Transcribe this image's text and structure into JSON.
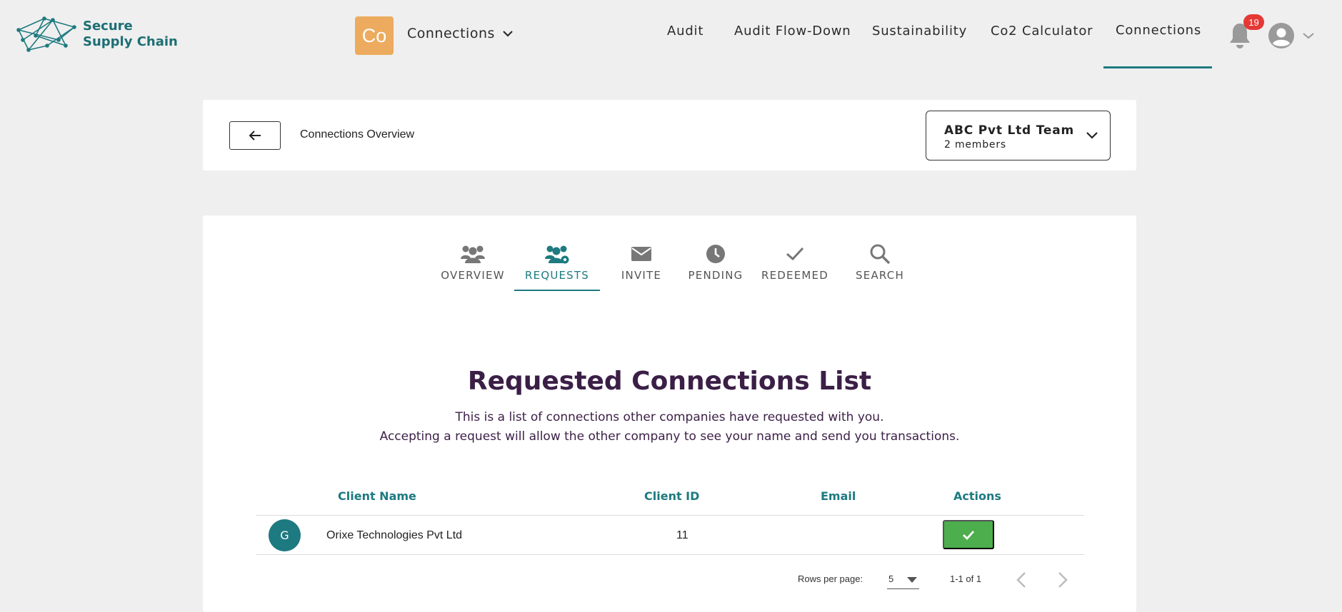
{
  "brand": {
    "line1": "Secure",
    "line2": "Supply Chain"
  },
  "app": {
    "badge": "Co",
    "name": "Connections"
  },
  "nav": {
    "items": [
      {
        "label": "Audit"
      },
      {
        "label": "Audit Flow-Down"
      },
      {
        "label": "Sustainability"
      },
      {
        "label": "Co2 Calculator"
      },
      {
        "label": "Connections",
        "active": true
      }
    ],
    "notifications_count": "19"
  },
  "overview": {
    "title": "Connections Overview"
  },
  "team": {
    "name": "ABC Pvt Ltd Team",
    "members": "2 members"
  },
  "tabs": [
    {
      "label": "OVERVIEW",
      "icon": "users-icon"
    },
    {
      "label": "REQUESTS",
      "icon": "users-cog-icon",
      "active": true
    },
    {
      "label": "INVITE",
      "icon": "envelope-icon"
    },
    {
      "label": "PENDING",
      "icon": "clock-icon"
    },
    {
      "label": "REDEEMED",
      "icon": "check-icon"
    },
    {
      "label": "SEARCH",
      "icon": "search-icon"
    }
  ],
  "requests": {
    "title": "Requested Connections List",
    "desc1": "This is a list of connections other companies have requested with you.",
    "desc2": "Accepting a request will allow the other company to see your name and send you transactions.",
    "columns": {
      "name": "Client Name",
      "id": "Client ID",
      "email": "Email",
      "actions": "Actions"
    },
    "rows": [
      {
        "avatar": "G",
        "name": "Orixe Technologies Pvt Ltd",
        "id": "11",
        "email": ""
      }
    ]
  },
  "pagination": {
    "rows_label": "Rows per page:",
    "rows_value": "5",
    "range": "1-1 of 1"
  },
  "colors": {
    "accent": "#1d7a80",
    "title": "#3b1f46",
    "badge": "#ecab5e",
    "accept": "#4cae4c",
    "alert": "#e53935"
  }
}
